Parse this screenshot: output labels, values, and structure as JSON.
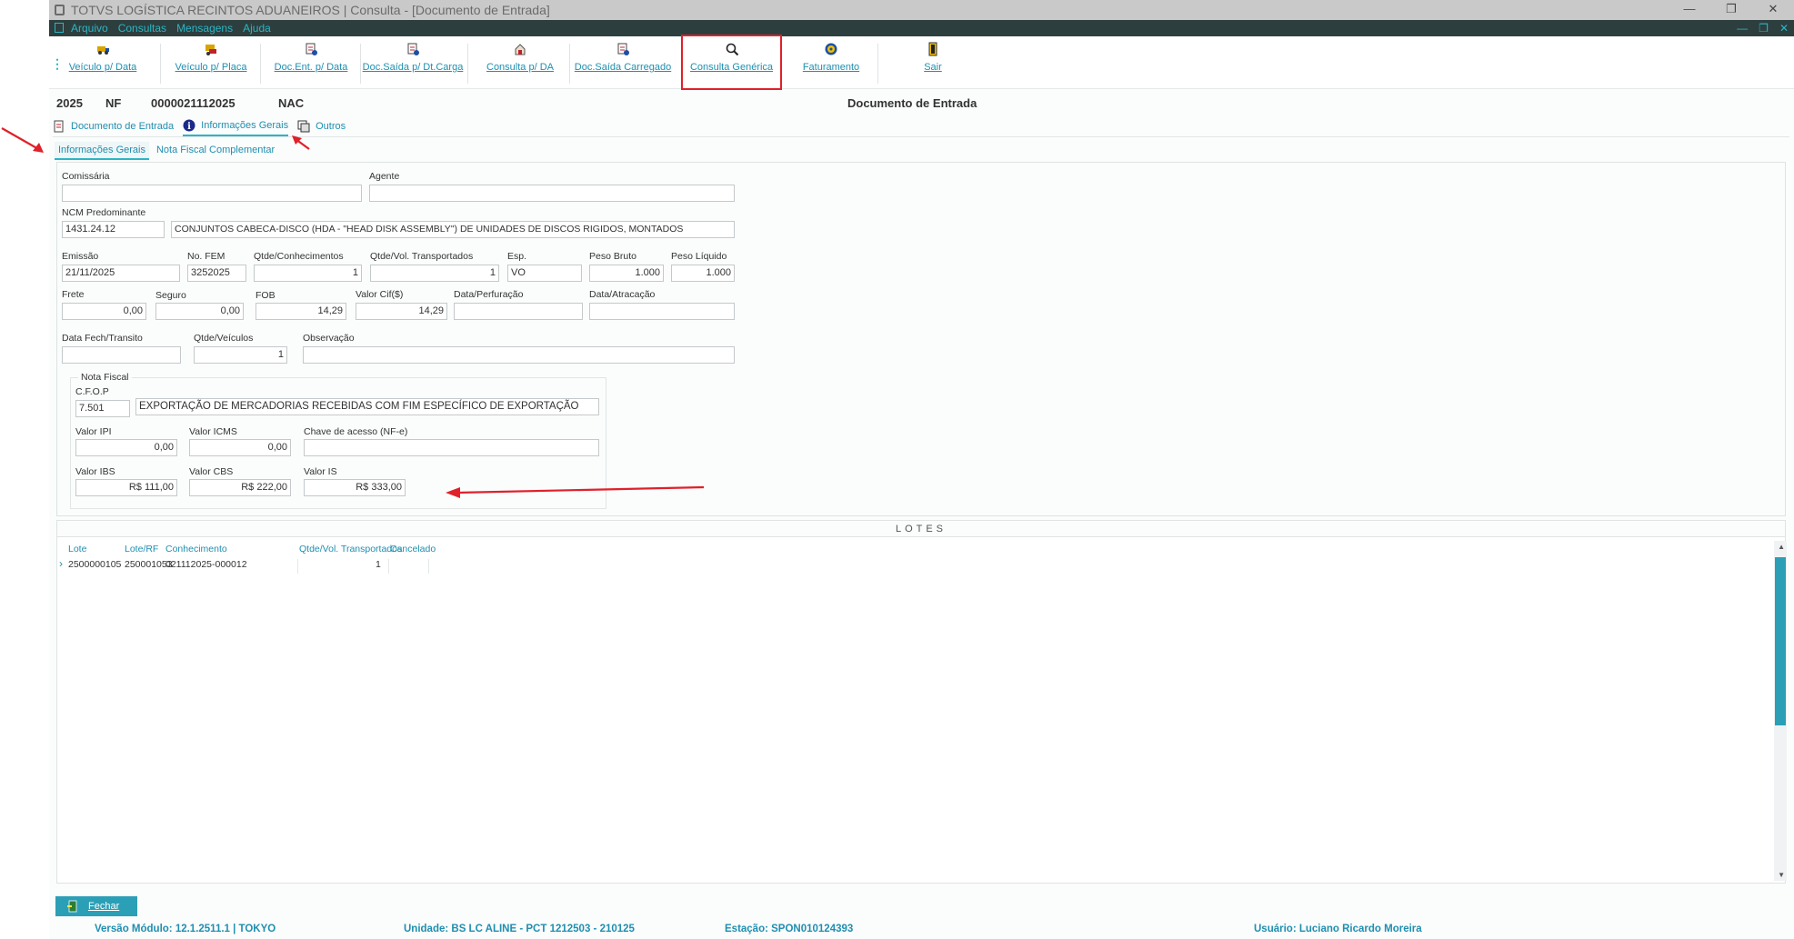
{
  "window": {
    "title": "TOTVS LOGÍSTICA RECINTOS ADUANEIROS | Consulta - [Documento de Entrada]",
    "controls": [
      "—",
      "❐",
      "✕"
    ]
  },
  "menu": {
    "items": [
      "Arquivo",
      "Consultas",
      "Mensagens",
      "Ajuda"
    ],
    "mdi_controls": [
      "—",
      "❐",
      "✕"
    ]
  },
  "toolbar": {
    "buttons": [
      {
        "label": "Veículo p/ Data",
        "icon": "truck-calendar-icon"
      },
      {
        "label": "Veículo p/ Placa",
        "icon": "truck-plate-icon"
      },
      {
        "label": "Doc.Ent. p/ Data",
        "icon": "doc-entry-icon"
      },
      {
        "label": "Doc.Saída p/ Dt.Carga",
        "icon": "doc-exit-icon"
      },
      {
        "label": "Consulta p/ DA",
        "icon": "query-da-icon"
      },
      {
        "label": "Doc.Saída Carregado",
        "icon": "doc-loaded-icon"
      },
      {
        "label": "Consulta Genérica",
        "icon": "magnifier-icon"
      },
      {
        "label": "Faturamento",
        "icon": "billing-icon"
      },
      {
        "label": "Sair",
        "icon": "exit-icon"
      }
    ]
  },
  "header": {
    "year": "2025",
    "type": "NF",
    "number": "0000021112025",
    "origin": "NAC",
    "title": "Documento de Entrada"
  },
  "tabs": {
    "main": [
      "Documento de Entrada",
      "Informações Gerais",
      "Outros"
    ],
    "sub": [
      "Informações Gerais",
      "Nota Fiscal Complementar"
    ]
  },
  "form": {
    "comissaria": {
      "label": "Comissária",
      "value": ""
    },
    "agente": {
      "label": "Agente",
      "value": ""
    },
    "ncm": {
      "label": "NCM Predominante",
      "code": "1431.24.12",
      "description": "CONJUNTOS CABECA-DISCO (HDA - \"HEAD DISK ASSEMBLY\") DE UNIDADES DE DISCOS RIGIDOS, MONTADOS"
    },
    "emissao": {
      "label": "Emissão",
      "value": "21/11/2025"
    },
    "no_fem": {
      "label": "No. FEM",
      "value": "3252025"
    },
    "qtde_conhecimentos": {
      "label": "Qtde/Conhecimentos",
      "value": "1"
    },
    "qtde_vol_transportados": {
      "label": "Qtde/Vol. Transportados",
      "value": "1"
    },
    "esp": {
      "label": "Esp.",
      "value": "VO"
    },
    "peso_bruto": {
      "label": "Peso Bruto",
      "value": "1.000"
    },
    "peso_liquido": {
      "label": "Peso Líquido",
      "value": "1.000"
    },
    "frete": {
      "label": "Frete",
      "value": "0,00"
    },
    "seguro": {
      "label": "Seguro",
      "value": "0,00"
    },
    "fob": {
      "label": "FOB",
      "value": "14,29"
    },
    "valor_cif": {
      "label": "Valor Cif($)",
      "value": "14,29"
    },
    "data_perfuracao": {
      "label": "Data/Perfuração",
      "value": ""
    },
    "data_atracacao": {
      "label": "Data/Atracação",
      "value": ""
    },
    "data_fech_transito": {
      "label": "Data Fech/Transito",
      "value": ""
    },
    "qtde_veiculos": {
      "label": "Qtde/Veículos",
      "value": "1"
    },
    "observacao": {
      "label": "Observação",
      "value": ""
    }
  },
  "nota_fiscal": {
    "legend": "Nota Fiscal",
    "cfop": {
      "label": "C.F.O.P",
      "code": "7.501",
      "description": "EXPORTAÇÃO DE MERCADORIAS RECEBIDAS COM FIM ESPECÍFICO DE EXPORTAÇÃO"
    },
    "valor_ipi": {
      "label": "Valor IPI",
      "value": "0,00"
    },
    "valor_icms": {
      "label": "Valor ICMS",
      "value": "0,00"
    },
    "chave_acesso": {
      "label": "Chave de acesso (NF-e)",
      "value": ""
    },
    "valor_ibs": {
      "label": "Valor IBS",
      "value": "R$ 111,00"
    },
    "valor_cbs": {
      "label": "Valor CBS",
      "value": "R$ 222,00"
    },
    "valor_is": {
      "label": "Valor IS",
      "value": "R$ 333,00"
    }
  },
  "lotes": {
    "title": "LOTES",
    "columns": [
      "Lote",
      "Lote/RF",
      "Conhecimento",
      "Qtde/Vol. Transportados",
      "Cancelado"
    ],
    "rows": [
      {
        "lote": "2500000105",
        "lote_rf": "250001053",
        "conhecimento": "021112025-000012",
        "qtde": "1",
        "cancelado": ""
      }
    ]
  },
  "footer": {
    "close_label": "Fechar",
    "versao": "Versão Módulo:  12.1.2511.1  |  TOKYO",
    "unidade": "Unidade: BS LC ALINE - PCT 1212503 - 210125",
    "estacao": "Estação: SPON010124393",
    "usuario": "Usuário: Luciano Ricardo Moreira"
  },
  "colors": {
    "accent": "#2bb5c4",
    "link": "#1f8fb0",
    "menubar": "#2d3e3e",
    "annotation": "#e0202a"
  }
}
